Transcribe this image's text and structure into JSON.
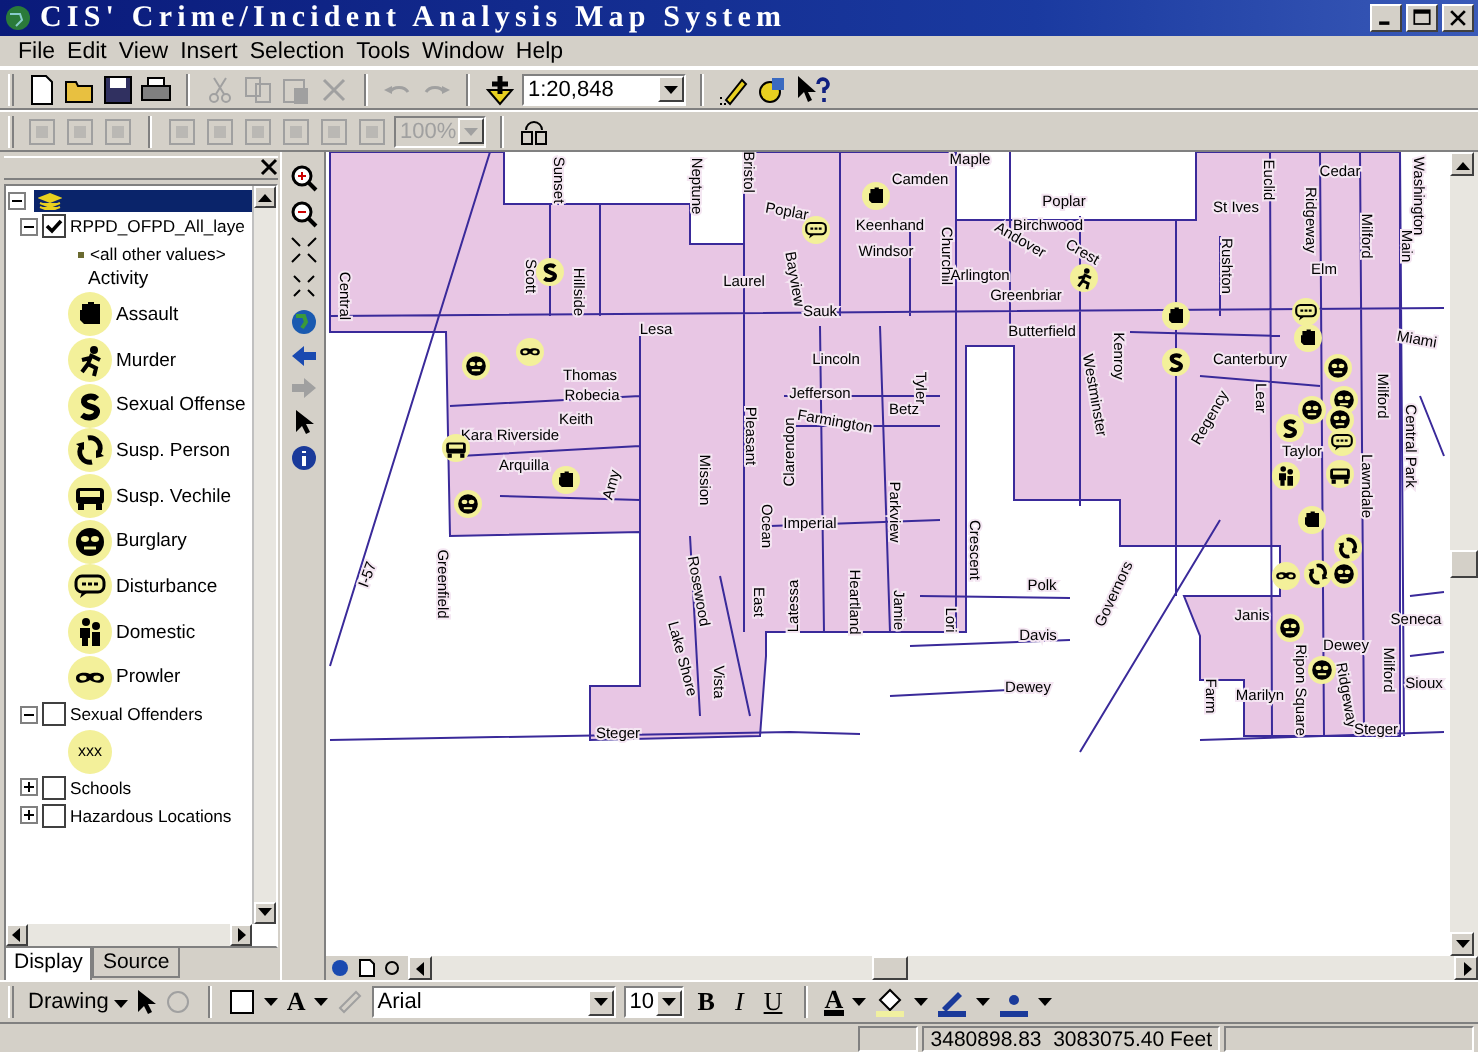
{
  "window": {
    "title": "CIS' Crime/Incident Analysis Map System"
  },
  "menu": [
    {
      "label": "File"
    },
    {
      "label": "Edit"
    },
    {
      "label": "View"
    },
    {
      "label": "Insert"
    },
    {
      "label": "Selection"
    },
    {
      "label": "Tools"
    },
    {
      "label": "Window"
    },
    {
      "label": "Help"
    }
  ],
  "toolbar": {
    "scale": "1:20,848"
  },
  "toolbar_2": {
    "zoom": "100%",
    "disabled": true
  },
  "toc": {
    "layers": [
      {
        "name": "RPPD_OFPD_All_laye",
        "checked": true,
        "expanded": true,
        "other_values": "<all other values>",
        "field": "Activity",
        "legend": [
          {
            "kind": "assault",
            "label": "Assault"
          },
          {
            "kind": "murder",
            "label": "Murder"
          },
          {
            "kind": "sexual",
            "label": "Sexual Offense"
          },
          {
            "kind": "person",
            "label": "Susp. Person"
          },
          {
            "kind": "vehicle",
            "label": "Susp. Vechile"
          },
          {
            "kind": "burglary",
            "label": "Burglary"
          },
          {
            "kind": "disturbance",
            "label": "Disturbance"
          },
          {
            "kind": "domestic",
            "label": "Domestic"
          },
          {
            "kind": "prowler",
            "label": "Prowler"
          }
        ]
      },
      {
        "name": "Sexual Offenders",
        "checked": false,
        "expanded": true,
        "legend": [
          {
            "kind": "text",
            "symbol": "xxx"
          }
        ]
      },
      {
        "name": "Schools",
        "checked": false,
        "expanded": false
      },
      {
        "name": "Hazardous Locations",
        "checked": false,
        "expanded": false
      }
    ]
  },
  "toc_tabs": [
    {
      "label": "Display",
      "selected": true
    },
    {
      "label": "Source",
      "selected": false
    }
  ],
  "map": {
    "streets": [
      {
        "name": "Sunset"
      },
      {
        "name": "Neptune"
      },
      {
        "name": "Bristol"
      },
      {
        "name": "Camden"
      },
      {
        "name": "Poplar"
      },
      {
        "name": "Keenhand"
      },
      {
        "name": "Windsor"
      },
      {
        "name": "Scott"
      },
      {
        "name": "Hillside"
      },
      {
        "name": "Laurel"
      },
      {
        "name": "Bayview"
      },
      {
        "name": "Sauk"
      },
      {
        "name": "Lesa"
      },
      {
        "name": "Lincoln"
      },
      {
        "name": "Thomas"
      },
      {
        "name": "Robecia"
      },
      {
        "name": "Keith"
      },
      {
        "name": "Kara Riverside"
      },
      {
        "name": "Arquilla"
      },
      {
        "name": "Amy"
      },
      {
        "name": "Jefferson"
      },
      {
        "name": "Farmington"
      },
      {
        "name": "Tyler"
      },
      {
        "name": "Betz"
      },
      {
        "name": "Pleasant"
      },
      {
        "name": "Mission"
      },
      {
        "name": "Clarendon"
      },
      {
        "name": "Ocean"
      },
      {
        "name": "Imperial"
      },
      {
        "name": "Parkview"
      },
      {
        "name": "Rosewood"
      },
      {
        "name": "East"
      },
      {
        "name": "Latessa"
      },
      {
        "name": "Heartland"
      },
      {
        "name": "Jamie"
      },
      {
        "name": "Crescent"
      },
      {
        "name": "Lori"
      },
      {
        "name": "Lake Shore"
      },
      {
        "name": "Vista"
      },
      {
        "name": "Steger"
      },
      {
        "name": "Greenfield"
      },
      {
        "name": "Central"
      },
      {
        "name": "I-57"
      },
      {
        "name": "Maple"
      },
      {
        "name": "Poplar"
      },
      {
        "name": "St Ives"
      },
      {
        "name": "Euclid"
      },
      {
        "name": "Birchwood"
      },
      {
        "name": "Andover"
      },
      {
        "name": "Crest"
      },
      {
        "name": "Churchill"
      },
      {
        "name": "Arlington"
      },
      {
        "name": "Greenbriar"
      },
      {
        "name": "Butterfield"
      },
      {
        "name": "Kenroy"
      },
      {
        "name": "Westminster"
      },
      {
        "name": "Rushton"
      },
      {
        "name": "Ridgeway"
      },
      {
        "name": "Cedar"
      },
      {
        "name": "Milford"
      },
      {
        "name": "Main"
      },
      {
        "name": "Washington"
      },
      {
        "name": "Elm"
      },
      {
        "name": "Miami"
      },
      {
        "name": "Canterbury"
      },
      {
        "name": "Regency"
      },
      {
        "name": "Lear"
      },
      {
        "name": "Central Park"
      },
      {
        "name": "Taylor"
      },
      {
        "name": "Lawndale"
      },
      {
        "name": "Milford"
      },
      {
        "name": "Polk"
      },
      {
        "name": "Davis"
      },
      {
        "name": "Dewey"
      },
      {
        "name": "Governors"
      },
      {
        "name": "Janis"
      },
      {
        "name": "Ripon Square"
      },
      {
        "name": "Dewey"
      },
      {
        "name": "Farm"
      },
      {
        "name": "Marilyn"
      },
      {
        "name": "Ridgeway"
      },
      {
        "name": "Steger"
      },
      {
        "name": "Seneca"
      },
      {
        "name": "Sioux"
      },
      {
        "name": "Milford"
      }
    ],
    "incidents": [
      {
        "kind": "assault"
      },
      {
        "kind": "disturbance"
      },
      {
        "kind": "sexual"
      },
      {
        "kind": "burglary"
      },
      {
        "kind": "prowler"
      },
      {
        "kind": "vehicle"
      },
      {
        "kind": "burglary"
      },
      {
        "kind": "assault"
      },
      {
        "kind": "murder"
      },
      {
        "kind": "assault"
      },
      {
        "kind": "sexual"
      },
      {
        "kind": "disturbance"
      },
      {
        "kind": "assault"
      },
      {
        "kind": "burglary"
      },
      {
        "kind": "burglary"
      },
      {
        "kind": "burglary"
      },
      {
        "kind": "burglary"
      },
      {
        "kind": "disturbance"
      },
      {
        "kind": "sexual"
      },
      {
        "kind": "domestic"
      },
      {
        "kind": "vehicle"
      },
      {
        "kind": "assault"
      },
      {
        "kind": "person"
      },
      {
        "kind": "prowler"
      },
      {
        "kind": "person"
      },
      {
        "kind": "burglary"
      },
      {
        "kind": "burglary"
      },
      {
        "kind": "burglary"
      }
    ]
  },
  "drawing_toolbar": {
    "menu": "Drawing",
    "text_tool": "A",
    "font": "Arial",
    "size": "10",
    "bold": "B",
    "italic": "I",
    "underline": "U",
    "font_color": "A"
  },
  "status_bar": {
    "coordinates": "3480898.83  3083075.40 Feet"
  }
}
